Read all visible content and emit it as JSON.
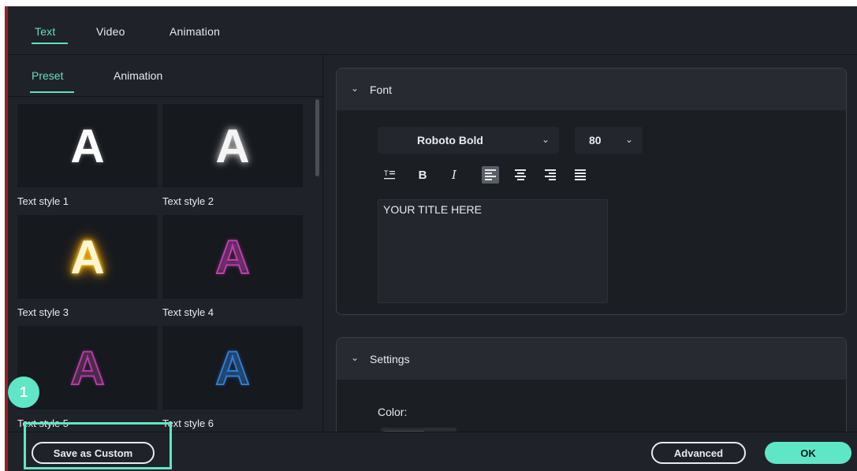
{
  "top_tabs": [
    "Text",
    "Video",
    "Animation"
  ],
  "sub_tabs": [
    "Preset",
    "Animation"
  ],
  "presets": [
    {
      "label": "Text style 1",
      "glyph": "A"
    },
    {
      "label": "Text style 2",
      "glyph": "A"
    },
    {
      "label": "Text style 3",
      "glyph": "A"
    },
    {
      "label": "Text style 4",
      "glyph": "A"
    },
    {
      "label": "Text style 5",
      "glyph": "A"
    },
    {
      "label": "Text style 6",
      "glyph": "A"
    }
  ],
  "font_section": {
    "title": "Font",
    "font_name": "Roboto Bold",
    "font_size": "80",
    "text_value": "YOUR TITLE HERE",
    "format_buttons": [
      "text-case-icon",
      "bold-icon",
      "italic-icon",
      "align-left-icon",
      "align-center-icon",
      "align-right-icon",
      "align-justify-icon"
    ],
    "bold_glyph": "B",
    "italic_glyph": "I"
  },
  "settings_section": {
    "title": "Settings",
    "color_label": "Color:"
  },
  "buttons": {
    "save_custom": "Save as Custom",
    "advanced": "Advanced",
    "ok": "OK"
  },
  "step_badge": "1",
  "colors": {
    "accent": "#5fe6c6",
    "background": "#1f2329",
    "red_edge": "#8f2228"
  }
}
